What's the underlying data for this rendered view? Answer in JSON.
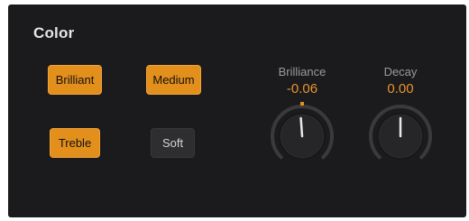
{
  "panel": {
    "title": "Color"
  },
  "buttons": {
    "brilliant": {
      "label": "Brilliant",
      "active": true
    },
    "medium": {
      "label": "Medium",
      "active": true
    },
    "treble": {
      "label": "Treble",
      "active": true
    },
    "soft": {
      "label": "Soft",
      "active": false
    }
  },
  "knobs": {
    "brilliance": {
      "label": "Brilliance",
      "value": "-0.06",
      "fraction": 0.485
    },
    "decay": {
      "label": "Decay",
      "value": "0.00",
      "fraction": 0.5
    }
  },
  "colors": {
    "accent": "#e38f1c",
    "panel_bg": "#1b1b1d",
    "value_text": "#e8932a"
  }
}
